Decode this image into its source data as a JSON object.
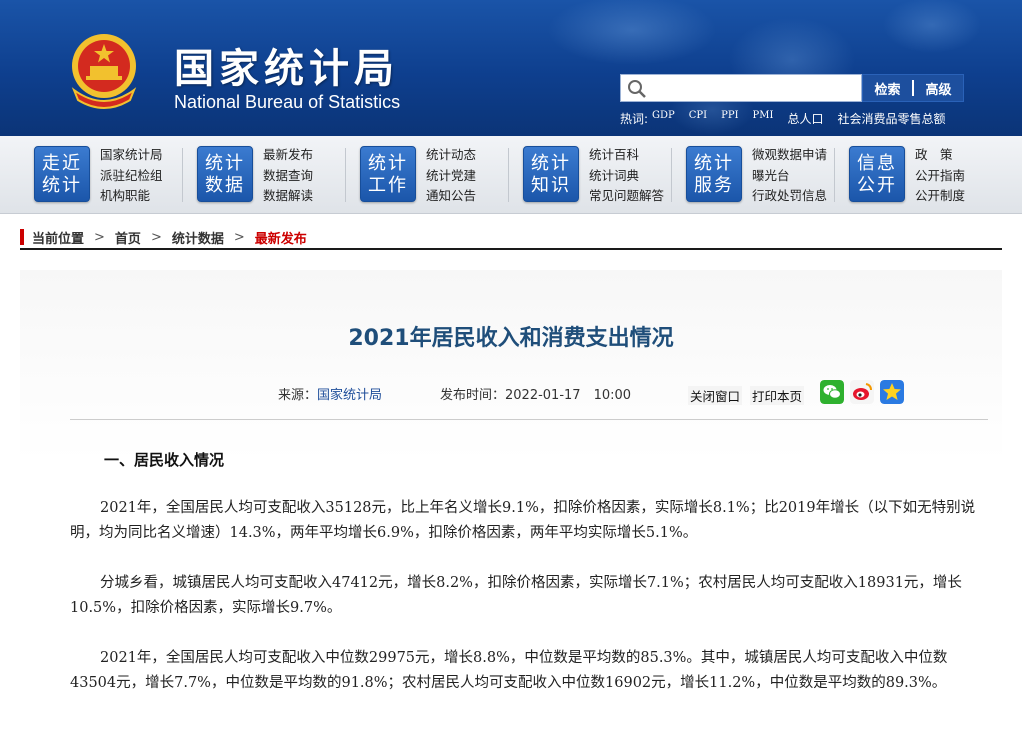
{
  "header": {
    "site_title_cn": "国家统计局",
    "site_title_en": "National Bureau of Statistics",
    "search": {
      "placeholder": "",
      "search_label": "检索",
      "advanced_label": "高级"
    },
    "hotwords_label": "热词:",
    "hotwords": [
      "GDP",
      "CPI",
      "PPI",
      "PMI",
      "总人口",
      "社会消费品零售总额"
    ]
  },
  "nav": {
    "groups": [
      {
        "badge": [
          "走近",
          "统计"
        ],
        "links": [
          "国家统计局",
          "派驻纪检组",
          "机构职能"
        ]
      },
      {
        "badge": [
          "统计",
          "数据"
        ],
        "links": [
          "最新发布",
          "数据查询",
          "数据解读"
        ]
      },
      {
        "badge": [
          "统计",
          "工作"
        ],
        "links": [
          "统计动态",
          "统计党建",
          "通知公告"
        ]
      },
      {
        "badge": [
          "统计",
          "知识"
        ],
        "links": [
          "统计百科",
          "统计词典",
          "常见问题解答"
        ]
      },
      {
        "badge": [
          "统计",
          "服务"
        ],
        "links": [
          "微观数据申请",
          "曝光台",
          "行政处罚信息"
        ]
      },
      {
        "badge": [
          "信息",
          "公开"
        ],
        "links": [
          "政　策",
          "公开指南",
          "公开制度"
        ]
      }
    ]
  },
  "breadcrumb": {
    "label": "当前位置",
    "items": [
      "首页",
      "统计数据",
      "最新发布"
    ]
  },
  "article": {
    "title": "2021年居民收入和消费支出情况",
    "source_label": "来源：",
    "source_value": "国家统计局",
    "time_label": "发布时间：",
    "time_value": "2022-01-17　10:00",
    "close_label": "关闭窗口",
    "print_label": "打印本页",
    "section_heading": "一、居民收入情况",
    "paragraphs": [
      "2021年，全国居民人均可支配收入35128元，比上年名义增长9.1%，扣除价格因素，实际增长8.1%；比2019年增长（以下如无特别说明，均为同比名义增速）14.3%，两年平均增长6.9%，扣除价格因素，两年平均实际增长5.1%。",
      "分城乡看，城镇居民人均可支配收入47412元，增长8.2%，扣除价格因素，实际增长7.1%；农村居民人均可支配收入18931元，增长10.5%，扣除价格因素，实际增长9.7%。",
      "2021年，全国居民人均可支配收入中位数29975元，增长8.8%，中位数是平均数的85.3%。其中，城镇居民人均可支配收入中位数43504元，增长7.7%，中位数是平均数的91.8%；农村居民人均可支配收入中位数16902元，增长11.2%，中位数是平均数的89.3%。"
    ]
  },
  "colors": {
    "header_blue": "#0e3f8e",
    "badge_blue": "#1b56aa",
    "title_blue": "#1f4e7a",
    "accent_red": "#cc0000"
  },
  "icons": [
    "search-icon",
    "national-emblem",
    "wechat-icon",
    "weibo-icon",
    "favorite-star-icon"
  ]
}
